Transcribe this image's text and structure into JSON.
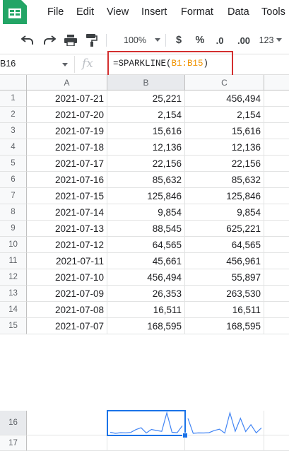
{
  "menu": {
    "items": [
      "File",
      "Edit",
      "View",
      "Insert",
      "Format",
      "Data",
      "Tools"
    ]
  },
  "toolbar": {
    "zoom": "100%",
    "currency": "$",
    "percent": "%",
    "decrease_decimals": ".0",
    "increase_decimals": ".00",
    "more_formats": "123"
  },
  "formula_bar": {
    "cell_ref": "B16",
    "fx": "fx",
    "formula_prefix": "=SPARKLINE(",
    "formula_range": "B1:B15",
    "formula_suffix": ")"
  },
  "sheet": {
    "columns": [
      "A",
      "B",
      "C"
    ],
    "rows": [
      {
        "num": "1",
        "a": "2021-07-21",
        "b": "25,221",
        "c": "456,494"
      },
      {
        "num": "2",
        "a": "2021-07-20",
        "b": "2,154",
        "c": "2,154"
      },
      {
        "num": "3",
        "a": "2021-07-19",
        "b": "15,616",
        "c": "15,616"
      },
      {
        "num": "4",
        "a": "2021-07-18",
        "b": "12,136",
        "c": "12,136"
      },
      {
        "num": "5",
        "a": "2021-07-17",
        "b": "22,156",
        "c": "22,156"
      },
      {
        "num": "6",
        "a": "2021-07-16",
        "b": "85,632",
        "c": "85,632"
      },
      {
        "num": "7",
        "a": "2021-07-15",
        "b": "125,846",
        "c": "125,846"
      },
      {
        "num": "8",
        "a": "2021-07-14",
        "b": "9,854",
        "c": "9,854"
      },
      {
        "num": "9",
        "a": "2021-07-13",
        "b": "88,545",
        "c": "625,221"
      },
      {
        "num": "10",
        "a": "2021-07-12",
        "b": "64,565",
        "c": "64,565"
      },
      {
        "num": "11",
        "a": "2021-07-11",
        "b": "45,661",
        "c": "456,961"
      },
      {
        "num": "12",
        "a": "2021-07-10",
        "b": "456,494",
        "c": "55,897"
      },
      {
        "num": "13",
        "a": "2021-07-09",
        "b": "26,353",
        "c": "263,530"
      },
      {
        "num": "14",
        "a": "2021-07-08",
        "b": "16,511",
        "c": "16,511"
      },
      {
        "num": "15",
        "a": "2021-07-07",
        "b": "168,595",
        "c": "168,595"
      }
    ],
    "extra_rows": [
      "16",
      "17"
    ]
  },
  "sparklines": {
    "b16": [
      25221,
      2154,
      15616,
      12136,
      22156,
      85632,
      125846,
      9854,
      88545,
      64565,
      45661,
      456494,
      26353,
      16511,
      168595
    ],
    "c16": [
      456494,
      2154,
      15616,
      12136,
      22156,
      85632,
      125846,
      9854,
      625221,
      64565,
      456961,
      55897,
      263530,
      16511,
      168595
    ]
  },
  "colors": {
    "sparkline": "#4285f4",
    "selection": "#1a73e8",
    "highlight": "#d32f2f",
    "range_ref": "#f09300"
  }
}
